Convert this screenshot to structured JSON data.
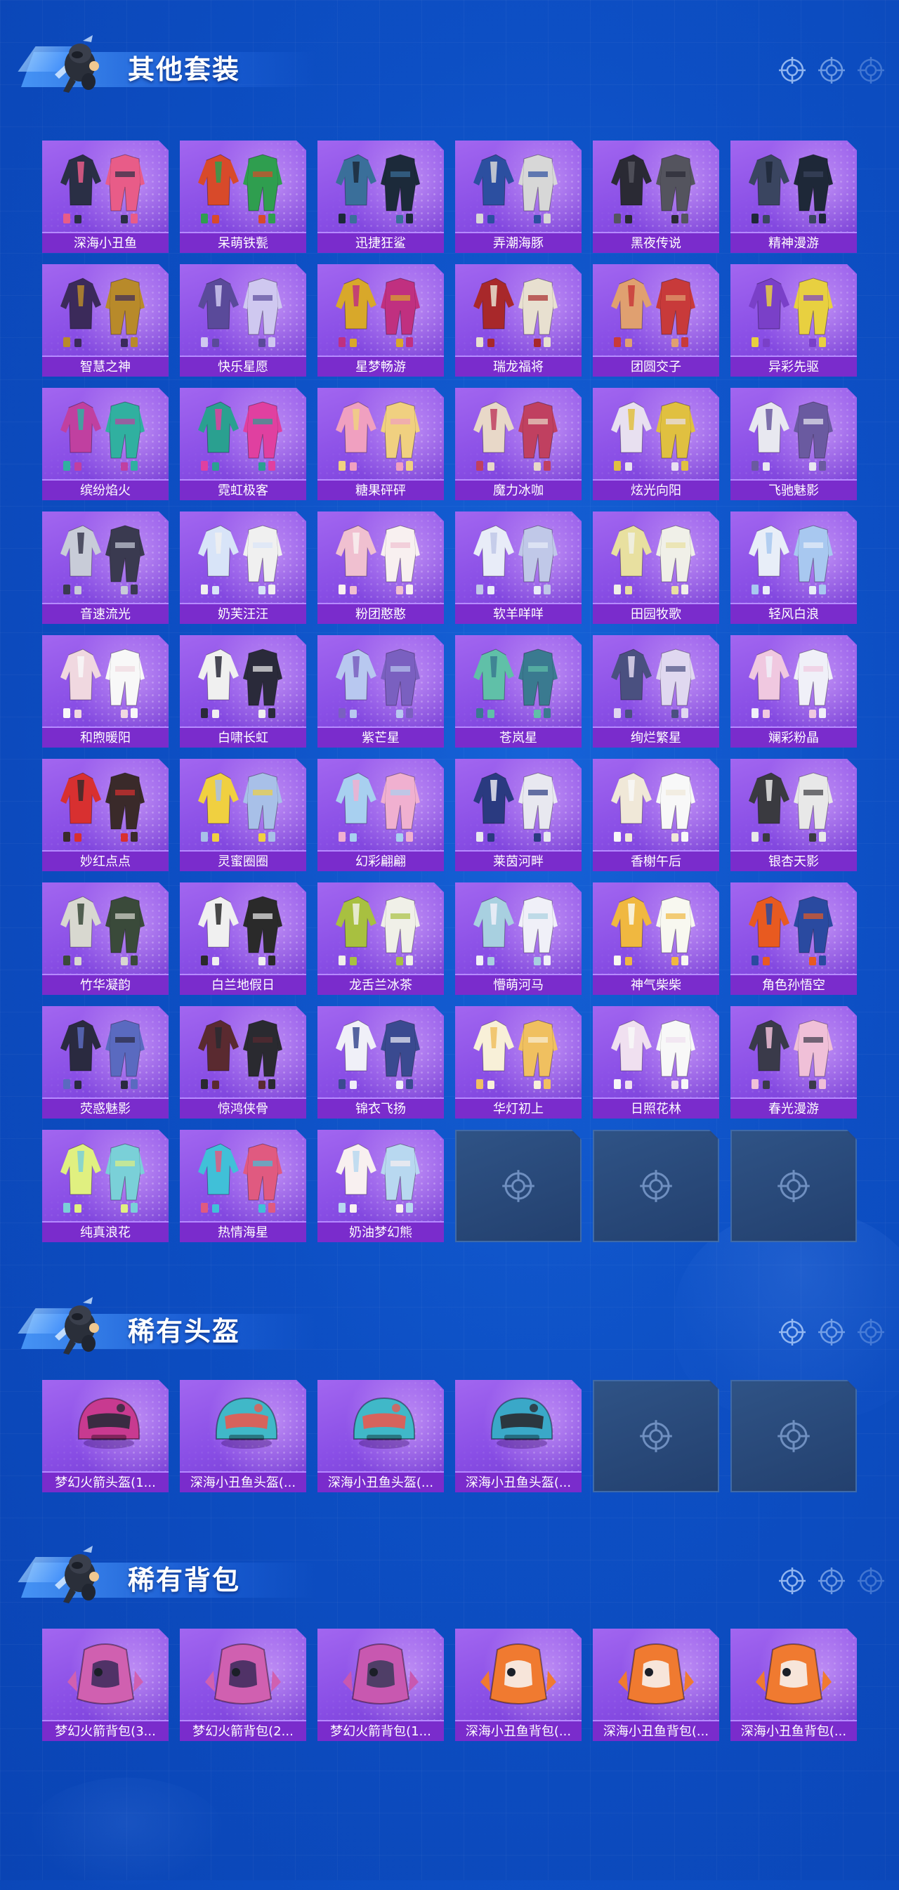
{
  "sections": [
    {
      "id": "suits",
      "title": "其他套装",
      "items": [
        {
          "name": "深海小丑鱼",
          "color": "#2a2f45",
          "accent": "#e85c88"
        },
        {
          "name": "呆萌铁甏",
          "color": "#d84a2a",
          "accent": "#2f9e4f"
        },
        {
          "name": "迅捷狂鲨",
          "color": "#3a6f9a",
          "accent": "#1c2a3a"
        },
        {
          "name": "弄潮海豚",
          "color": "#2c4fa0",
          "accent": "#d7d7d7"
        },
        {
          "name": "黑夜传说",
          "color": "#2a2a34",
          "accent": "#54545e"
        },
        {
          "name": "精神漫游",
          "color": "#3a4560",
          "accent": "#1e2838"
        },
        {
          "name": "智慧之神",
          "color": "#3b2a5a",
          "accent": "#b88a2a"
        },
        {
          "name": "快乐星愿",
          "color": "#5a4a9a",
          "accent": "#cfc8f0"
        },
        {
          "name": "星梦畅游",
          "color": "#d8a82a",
          "accent": "#c03080"
        },
        {
          "name": "瑞龙福将",
          "color": "#a8282a",
          "accent": "#e8e0d0"
        },
        {
          "name": "团圆交子",
          "color": "#e0a070",
          "accent": "#c83a3a"
        },
        {
          "name": "异彩先驱",
          "color": "#7a40c8",
          "accent": "#e8d040"
        },
        {
          "name": "缤纷焰火",
          "color": "#c040a0",
          "accent": "#30b0a0"
        },
        {
          "name": "霓虹极客",
          "color": "#2aa090",
          "accent": "#e040a0"
        },
        {
          "name": "糖果砰砰",
          "color": "#f0a0c0",
          "accent": "#f0d080"
        },
        {
          "name": "魔力冰咖",
          "color": "#e8d8c8",
          "accent": "#c04060"
        },
        {
          "name": "炫光向阳",
          "color": "#e8e0f0",
          "accent": "#e0c040"
        },
        {
          "name": "飞驰魅影",
          "color": "#e8e8f0",
          "accent": "#6a5aa0"
        },
        {
          "name": "音速流光",
          "color": "#c8ccd8",
          "accent": "#3a3a50"
        },
        {
          "name": "奶芙汪汪",
          "color": "#d8e4f8",
          "accent": "#f0f0f0"
        },
        {
          "name": "粉团憨憨",
          "color": "#f0c0d0",
          "accent": "#f8f0f0"
        },
        {
          "name": "软羊咩咩",
          "color": "#e8ecf8",
          "accent": "#c0c8e8"
        },
        {
          "name": "田园牧歌",
          "color": "#e8e0a0",
          "accent": "#f0f0e8"
        },
        {
          "name": "轻风白浪",
          "color": "#e8eef8",
          "accent": "#a8c8f0"
        },
        {
          "name": "和煦暖阳",
          "color": "#f0d8e0",
          "accent": "#f8f8f8"
        },
        {
          "name": "白啸长虹",
          "color": "#f0f0f0",
          "accent": "#2a2a3a"
        },
        {
          "name": "紫芒星",
          "color": "#b8c8f0",
          "accent": "#7a60c0"
        },
        {
          "name": "苍岚星",
          "color": "#60c0a8",
          "accent": "#3a7a90"
        },
        {
          "name": "绚烂繁星",
          "color": "#4a5080",
          "accent": "#e0d8f0"
        },
        {
          "name": "斓彩粉晶",
          "color": "#f0c8e0",
          "accent": "#f0f0f8"
        },
        {
          "name": "妙红点点",
          "color": "#d83030",
          "accent": "#3a2a2a"
        },
        {
          "name": "灵蜜圈圈",
          "color": "#f0d040",
          "accent": "#a8c0e8"
        },
        {
          "name": "幻彩翩翩",
          "color": "#a8d0f0",
          "accent": "#f0b0d0"
        },
        {
          "name": "莱茵河畔",
          "color": "#2a3a80",
          "accent": "#e8e8f0"
        },
        {
          "name": "香榭午后",
          "color": "#f0e8d8",
          "accent": "#f8f8f8"
        },
        {
          "name": "银杏天影",
          "color": "#3a3a40",
          "accent": "#e8e8e8"
        },
        {
          "name": "竹华凝韵",
          "color": "#d8d8d0",
          "accent": "#3a4a3a"
        },
        {
          "name": "白兰地假日",
          "color": "#f0f0f0",
          "accent": "#2a2a2a"
        },
        {
          "name": "龙舌兰冰茶",
          "color": "#a8c040",
          "accent": "#f0f0e8"
        },
        {
          "name": "懵萌河马",
          "color": "#a8d0e0",
          "accent": "#f0f0f8"
        },
        {
          "name": "神气柴柴",
          "color": "#f0b840",
          "accent": "#f8f8f0"
        },
        {
          "name": "角色孙悟空",
          "color": "#e85a20",
          "accent": "#2a4aa0"
        },
        {
          "name": "荧惑魅影",
          "color": "#2a2a40",
          "accent": "#5a6ac0"
        },
        {
          "name": "惊鸿侠骨",
          "color": "#5a2a30",
          "accent": "#2a2a30"
        },
        {
          "name": "锦衣飞扬",
          "color": "#f0f0f8",
          "accent": "#3a4a90"
        },
        {
          "name": "华灯初上",
          "color": "#f8f0d8",
          "accent": "#f0c060"
        },
        {
          "name": "日照花林",
          "color": "#f0e0f0",
          "accent": "#f8f8f8"
        },
        {
          "name": "春光漫游",
          "color": "#3a3a4a",
          "accent": "#f0c0d8"
        },
        {
          "name": "纯真浪花",
          "color": "#e0f080",
          "accent": "#7ad0d8"
        },
        {
          "name": "热情海星",
          "color": "#40c0d8",
          "accent": "#e05a80"
        },
        {
          "name": "奶油梦幻熊",
          "color": "#f8f0f0",
          "accent": "#b8d8f0"
        }
      ],
      "empty_slots": 3
    },
    {
      "id": "helmets",
      "title": "稀有头盔",
      "items": [
        {
          "name": "梦幻火箭头盔(1...",
          "color": "#c83a90",
          "accent": "#2a2a3a"
        },
        {
          "name": "深海小丑鱼头盔(...",
          "color": "#40b8c8",
          "accent": "#e85a50"
        },
        {
          "name": "深海小丑鱼头盔(...",
          "color": "#40b8c8",
          "accent": "#e85a50"
        },
        {
          "name": "深海小丑鱼头盔(...",
          "color": "#3aa8c8",
          "accent": "#2a2a30"
        }
      ],
      "empty_slots": 2
    },
    {
      "id": "backpacks",
      "title": "稀有背包",
      "items": [
        {
          "name": "梦幻火箭背包(3...",
          "color": "#d060b0",
          "accent": "#3a2a5a"
        },
        {
          "name": "梦幻火箭背包(2...",
          "color": "#d060b0",
          "accent": "#3a2a5a"
        },
        {
          "name": "梦幻火箭背包(1...",
          "color": "#c858b0",
          "accent": "#3a3a5a"
        },
        {
          "name": "深海小丑鱼背包(...",
          "color": "#f07a30",
          "accent": "#f8f8f8"
        },
        {
          "name": "深海小丑鱼背包(...",
          "color": "#f07a30",
          "accent": "#f8f8f8"
        },
        {
          "name": "深海小丑鱼背包(...",
          "color": "#f07a30",
          "accent": "#f8f8f8"
        }
      ],
      "empty_slots": 0
    }
  ]
}
